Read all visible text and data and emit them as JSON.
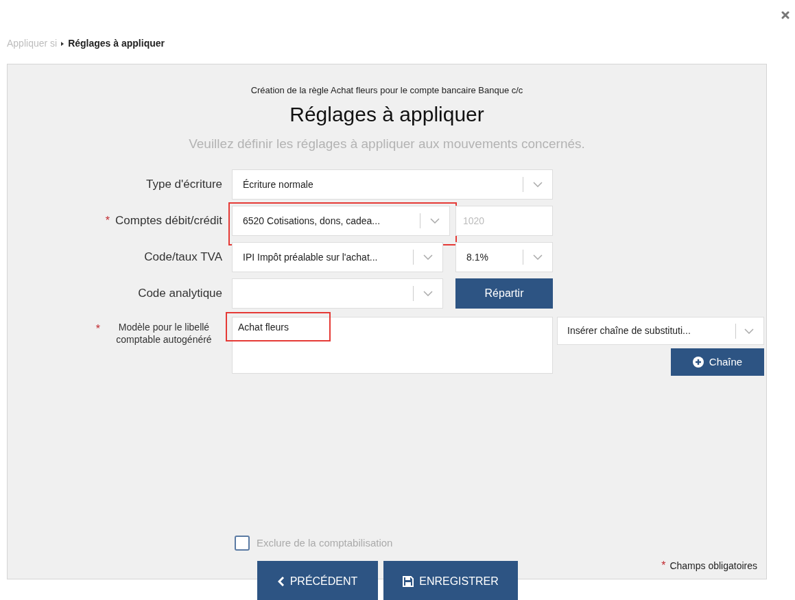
{
  "required_symbol": "*",
  "breadcrumb": [
    {
      "label": "Appliquer si",
      "selected": false
    },
    {
      "label": "Réglages à appliquer",
      "selected": true
    }
  ],
  "panel": {
    "context": "Création de la règle Achat fleurs pour le compte bancaire Banque c/c",
    "title": "Réglages à appliquer",
    "subtitle": "Veuillez définir les réglages à appliquer aux mouvements concernés."
  },
  "rows": [
    {
      "label": "Type d'écriture",
      "required": false,
      "controls": [
        {
          "kind": "select",
          "value": "Écriture normale",
          "highlighted": false
        }
      ]
    },
    {
      "label": "Comptes débit/crédit",
      "required": true,
      "controls": [
        {
          "kind": "select",
          "value": "6520 Cotisations, dons, cadea...",
          "highlighted": true
        },
        {
          "kind": "input",
          "placeholder": "1020",
          "highlighted": false
        }
      ]
    },
    {
      "label": "Code/taux TVA",
      "required": false,
      "controls": [
        {
          "kind": "select",
          "value": "IPI Impôt préalable sur l'achat...",
          "highlighted": false
        },
        {
          "kind": "select",
          "value": "8.1%",
          "highlighted": false
        }
      ]
    },
    {
      "label": "Code analytique",
      "required": false,
      "controls": [
        {
          "kind": "select",
          "highlighted": false
        },
        {
          "kind": "button",
          "label": "Répartir",
          "highlighted": false
        }
      ]
    }
  ],
  "template": {
    "label": "Modèle pour le libellé comptable autogénéré",
    "required": true,
    "value": "Achat fleurs",
    "highlighted": true,
    "substitution": "Insérer chaîne de substituti...",
    "add_button": "Chaîne"
  },
  "exclude": {
    "label": "Exclure de la comptabilisation",
    "checked": false
  },
  "required_note": "Champs obligatoires",
  "buttons": [
    {
      "kind": "back",
      "label": "PRÉCÉDENT"
    },
    {
      "kind": "save",
      "label": "ENREGISTRER"
    }
  ]
}
